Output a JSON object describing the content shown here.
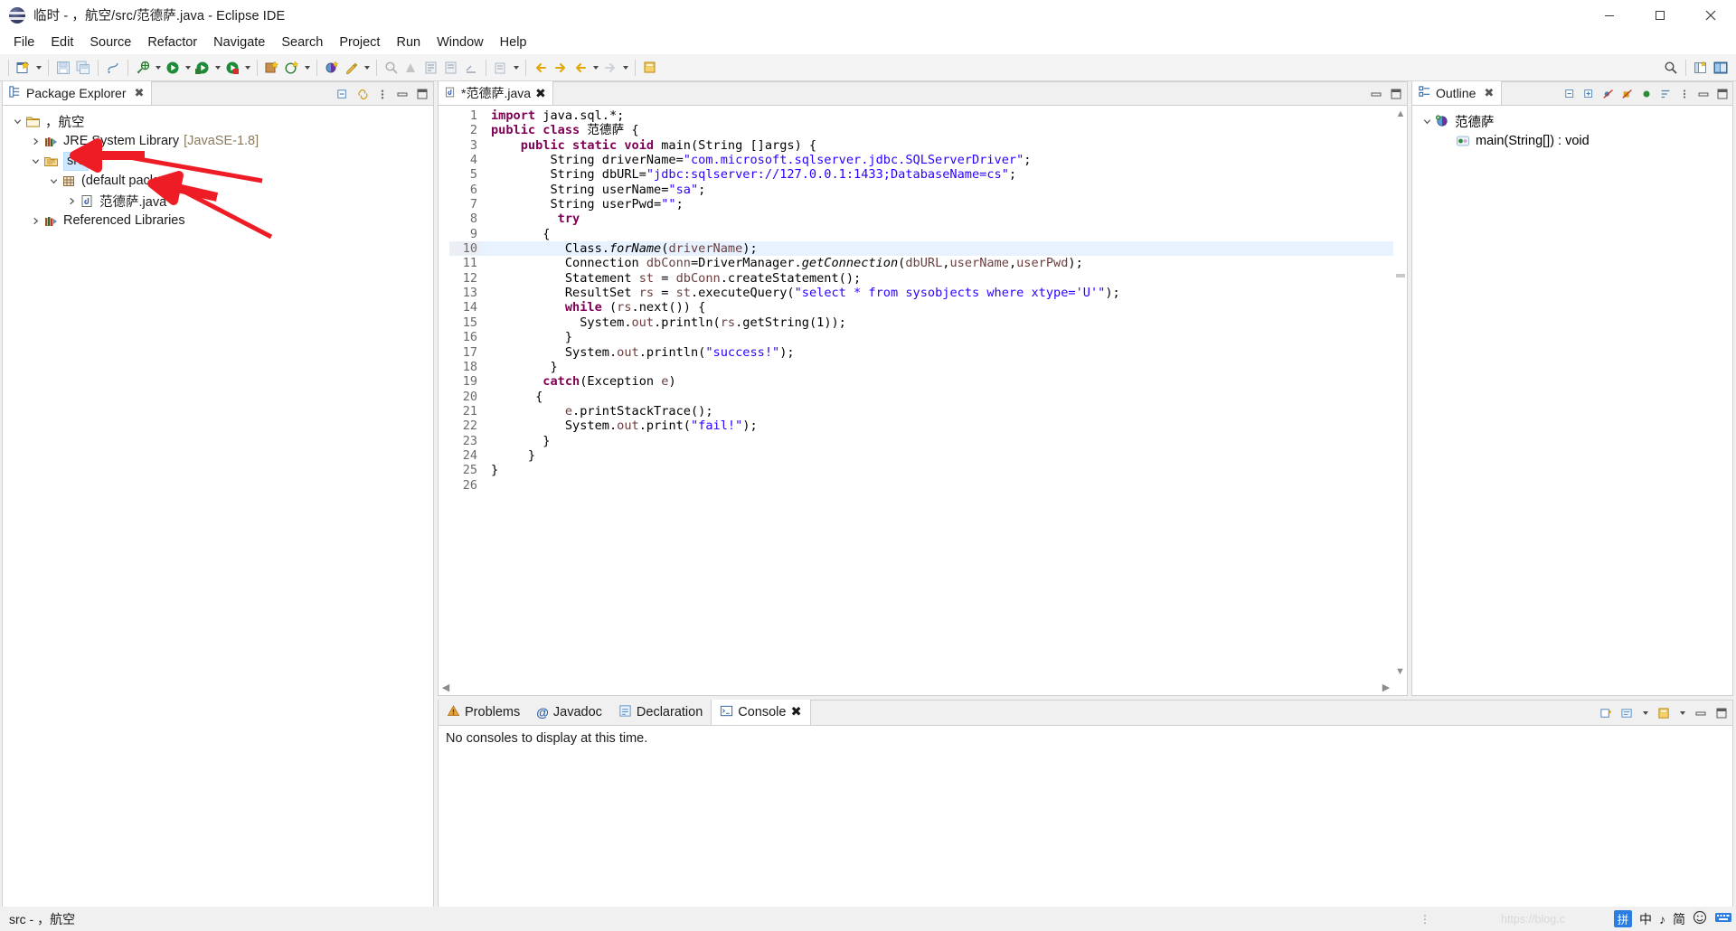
{
  "window": {
    "title": "临时 - ，航空/src/范德萨.java - Eclipse IDE",
    "icon": "eclipse-icon",
    "minimize": "minimize-button",
    "maximize": "maximize-button",
    "close": "close-button"
  },
  "menubar": {
    "items": [
      {
        "label": "File"
      },
      {
        "label": "Edit"
      },
      {
        "label": "Source"
      },
      {
        "label": "Refactor"
      },
      {
        "label": "Navigate"
      },
      {
        "label": "Search"
      },
      {
        "label": "Project"
      },
      {
        "label": "Run"
      },
      {
        "label": "Window"
      },
      {
        "label": "Help"
      }
    ]
  },
  "toolbar": {
    "icons": [
      "new-wizard-icon",
      "save-icon",
      "save-all-icon",
      "print-icon",
      "build-icon",
      "debug-icon",
      "run-icon",
      "run-coverage-icon",
      "new-java-project-icon",
      "new-java-package-icon",
      "new-class-icon",
      "search-icon",
      "open-type-icon",
      "next-annotation-icon",
      "previous-annotation-icon",
      "last-edit-location-icon",
      "back-icon",
      "forward-icon",
      "pin-editor-icon"
    ],
    "right_icons": [
      "quick-access-search-icon",
      "open-perspective-icon",
      "java-perspective-icon"
    ]
  },
  "package_explorer": {
    "tab_label": "Package Explorer",
    "tab_icon": "package-explorer-icon",
    "close_icon": "close-icon",
    "actions": [
      "collapse-all-icon",
      "link-with-editor-icon",
      "view-menu-icon",
      "minimize-icon",
      "maximize-icon"
    ],
    "tree": [
      {
        "label": "，航空",
        "icon": "java-project-icon",
        "depth": 0,
        "expanded": true,
        "selected": false,
        "suffix": ""
      },
      {
        "label": "JRE System Library",
        "icon": "jre-library-icon",
        "depth": 1,
        "expanded": false,
        "selected": false,
        "suffix": "[JavaSE-1.8]"
      },
      {
        "label": "src",
        "icon": "source-folder-icon",
        "depth": 1,
        "expanded": true,
        "selected": true,
        "suffix": ""
      },
      {
        "label": "(default package)",
        "icon": "package-icon",
        "depth": 2,
        "expanded": true,
        "selected": false,
        "suffix": ""
      },
      {
        "label": "范德萨.java",
        "icon": "java-file-icon",
        "depth": 3,
        "expanded": false,
        "selected": false,
        "suffix": ""
      },
      {
        "label": "Referenced Libraries",
        "icon": "referenced-libraries-icon",
        "depth": 1,
        "expanded": false,
        "selected": false,
        "suffix": ""
      }
    ]
  },
  "editor": {
    "tab_label": "*范德萨.java",
    "tab_icon": "java-file-icon",
    "close_icon": "close-icon",
    "current_line": 10,
    "lines": [
      {
        "n": 1,
        "folding": false,
        "tokens": [
          {
            "t": "import ",
            "c": "k"
          },
          {
            "t": "java.sql.*;",
            "c": "id"
          }
        ]
      },
      {
        "n": 2,
        "folding": false,
        "tokens": [
          {
            "t": "public class ",
            "c": "k"
          },
          {
            "t": "范德萨 {",
            "c": "id"
          }
        ]
      },
      {
        "n": 3,
        "folding": true,
        "tokens": [
          {
            "t": "    ",
            "c": "id"
          },
          {
            "t": "public static void ",
            "c": "k"
          },
          {
            "t": "main(String []args) {",
            "c": "id"
          }
        ]
      },
      {
        "n": 4,
        "folding": false,
        "tokens": [
          {
            "t": "        String driverName=",
            "c": "id"
          },
          {
            "t": "\"com.microsoft.sqlserver.jdbc.SQLServerDriver\"",
            "c": "s"
          },
          {
            "t": ";",
            "c": "id"
          }
        ]
      },
      {
        "n": 5,
        "folding": false,
        "tokens": [
          {
            "t": "        String dbURL=",
            "c": "id"
          },
          {
            "t": "\"jdbc:sqlserver://127.0.0.1:1433;DatabaseName=cs\"",
            "c": "s"
          },
          {
            "t": ";",
            "c": "id"
          }
        ]
      },
      {
        "n": 6,
        "folding": false,
        "tokens": [
          {
            "t": "        String userName=",
            "c": "id"
          },
          {
            "t": "\"sa\"",
            "c": "s"
          },
          {
            "t": ";",
            "c": "id"
          }
        ]
      },
      {
        "n": 7,
        "folding": false,
        "tokens": [
          {
            "t": "        String userPwd=",
            "c": "id"
          },
          {
            "t": "\"\"",
            "c": "s"
          },
          {
            "t": ";",
            "c": "id"
          }
        ]
      },
      {
        "n": 8,
        "folding": false,
        "tokens": [
          {
            "t": "         ",
            "c": "id"
          },
          {
            "t": "try",
            "c": "k"
          }
        ]
      },
      {
        "n": 9,
        "folding": false,
        "tokens": [
          {
            "t": "       {",
            "c": "id"
          }
        ]
      },
      {
        "n": 10,
        "folding": false,
        "tokens": [
          {
            "t": "          Class.",
            "c": "id"
          },
          {
            "t": "forName",
            "c": "mth"
          },
          {
            "t": "(",
            "c": "id"
          },
          {
            "t": "driverName",
            "c": "fld"
          },
          {
            "t": ");",
            "c": "id"
          }
        ]
      },
      {
        "n": 11,
        "folding": false,
        "tokens": [
          {
            "t": "          Connection ",
            "c": "id"
          },
          {
            "t": "dbConn",
            "c": "fld"
          },
          {
            "t": "=DriverManager.",
            "c": "id"
          },
          {
            "t": "getConnection",
            "c": "mth"
          },
          {
            "t": "(",
            "c": "id"
          },
          {
            "t": "dbURL",
            "c": "fld"
          },
          {
            "t": ",",
            "c": "id"
          },
          {
            "t": "userName",
            "c": "fld"
          },
          {
            "t": ",",
            "c": "id"
          },
          {
            "t": "userPwd",
            "c": "fld"
          },
          {
            "t": ");",
            "c": "id"
          }
        ]
      },
      {
        "n": 12,
        "folding": false,
        "tokens": [
          {
            "t": "          Statement ",
            "c": "id"
          },
          {
            "t": "st",
            "c": "fld"
          },
          {
            "t": " = ",
            "c": "id"
          },
          {
            "t": "dbConn",
            "c": "fld"
          },
          {
            "t": ".createStatement();",
            "c": "id"
          }
        ]
      },
      {
        "n": 13,
        "folding": false,
        "tokens": [
          {
            "t": "          ResultSet ",
            "c": "id"
          },
          {
            "t": "rs",
            "c": "fld"
          },
          {
            "t": " = ",
            "c": "id"
          },
          {
            "t": "st",
            "c": "fld"
          },
          {
            "t": ".executeQuery(",
            "c": "id"
          },
          {
            "t": "\"select * from sysobjects where xtype='U'\"",
            "c": "s"
          },
          {
            "t": ");",
            "c": "id"
          }
        ]
      },
      {
        "n": 14,
        "folding": false,
        "tokens": [
          {
            "t": "          ",
            "c": "id"
          },
          {
            "t": "while ",
            "c": "k"
          },
          {
            "t": "(",
            "c": "id"
          },
          {
            "t": "rs",
            "c": "fld"
          },
          {
            "t": ".next()) {",
            "c": "id"
          }
        ]
      },
      {
        "n": 15,
        "folding": false,
        "tokens": [
          {
            "t": "            System.",
            "c": "id"
          },
          {
            "t": "out",
            "c": "fld"
          },
          {
            "t": ".println(",
            "c": "id"
          },
          {
            "t": "rs",
            "c": "fld"
          },
          {
            "t": ".getString(1));",
            "c": "id"
          }
        ]
      },
      {
        "n": 16,
        "folding": false,
        "tokens": [
          {
            "t": "          }",
            "c": "id"
          }
        ]
      },
      {
        "n": 17,
        "folding": false,
        "tokens": [
          {
            "t": "          System.",
            "c": "id"
          },
          {
            "t": "out",
            "c": "fld"
          },
          {
            "t": ".println(",
            "c": "id"
          },
          {
            "t": "\"success!\"",
            "c": "s"
          },
          {
            "t": ");",
            "c": "id"
          }
        ]
      },
      {
        "n": 18,
        "folding": false,
        "tokens": [
          {
            "t": "        }",
            "c": "id"
          }
        ]
      },
      {
        "n": 19,
        "folding": false,
        "tokens": [
          {
            "t": "       ",
            "c": "id"
          },
          {
            "t": "catch",
            "c": "k"
          },
          {
            "t": "(Exception ",
            "c": "id"
          },
          {
            "t": "e",
            "c": "fld"
          },
          {
            "t": ")",
            "c": "id"
          }
        ]
      },
      {
        "n": 20,
        "folding": false,
        "tokens": [
          {
            "t": "      {",
            "c": "id"
          }
        ]
      },
      {
        "n": 21,
        "folding": false,
        "tokens": [
          {
            "t": "          ",
            "c": "id"
          },
          {
            "t": "e",
            "c": "fld"
          },
          {
            "t": ".printStackTrace();",
            "c": "id"
          }
        ]
      },
      {
        "n": 22,
        "folding": false,
        "tokens": [
          {
            "t": "          System.",
            "c": "id"
          },
          {
            "t": "out",
            "c": "fld"
          },
          {
            "t": ".print(",
            "c": "id"
          },
          {
            "t": "\"fail!\"",
            "c": "s"
          },
          {
            "t": ");",
            "c": "id"
          }
        ]
      },
      {
        "n": 23,
        "folding": false,
        "tokens": [
          {
            "t": "       }",
            "c": "id"
          }
        ]
      },
      {
        "n": 24,
        "folding": false,
        "tokens": [
          {
            "t": "     }",
            "c": "id"
          }
        ]
      },
      {
        "n": 25,
        "folding": false,
        "tokens": [
          {
            "t": "}",
            "c": "id"
          }
        ]
      },
      {
        "n": 26,
        "folding": false,
        "tokens": []
      }
    ]
  },
  "outline": {
    "tab_label": "Outline",
    "tab_icon": "outline-icon",
    "close_icon": "close-icon",
    "actions": [
      "collapse-all-icon",
      "expand-all-icon",
      "hide-fields-icon",
      "hide-static-icon",
      "hide-nonpublic-icon",
      "sort-icon",
      "view-menu-icon",
      "minimize-icon",
      "maximize-icon"
    ],
    "tree": [
      {
        "label": "范德萨",
        "icon": "java-class-icon",
        "depth": 0,
        "expanded": true
      },
      {
        "label": "main(String[]) : void",
        "icon": "public-method-icon",
        "depth": 1,
        "expanded": false
      }
    ]
  },
  "console": {
    "tabs": [
      {
        "label": "Problems",
        "icon": "problems-icon",
        "active": false
      },
      {
        "label": "Javadoc",
        "icon": "javadoc-icon",
        "active": false
      },
      {
        "label": "Declaration",
        "icon": "declaration-icon",
        "active": false
      },
      {
        "label": "Console",
        "icon": "console-icon",
        "active": true
      }
    ],
    "close_icon": "close-icon",
    "message": "No consoles to display at this time.",
    "actions": [
      "new-console-view-icon",
      "open-console-icon",
      "pin-console-icon",
      "display-selected-console-icon",
      "minimize-icon",
      "maximize-icon"
    ]
  },
  "statusbar": {
    "left_text": "src - ，航空",
    "watermark": "https://blog.c",
    "ime": {
      "mode_badge": "拼",
      "chinese_label": "中",
      "tone_icon": "music-note-icon",
      "simplified_label": "简",
      "emoji_icon": "emoji-icon",
      "keyboard_icon": "keyboard-icon"
    }
  },
  "annotations": {
    "arrow_color": "#ee1c25",
    "arrows": [
      {
        "name": "arrow-pointing-to-src"
      },
      {
        "name": "arrow-pointing-to-java-file"
      }
    ]
  },
  "colors": {
    "selection_blue": "#cde8ff",
    "current_line": "#e8f2fe",
    "keyword": "#7f0055",
    "string": "#2a00ff",
    "field": "#6a3e3e",
    "accent_red": "#ee1c25"
  }
}
